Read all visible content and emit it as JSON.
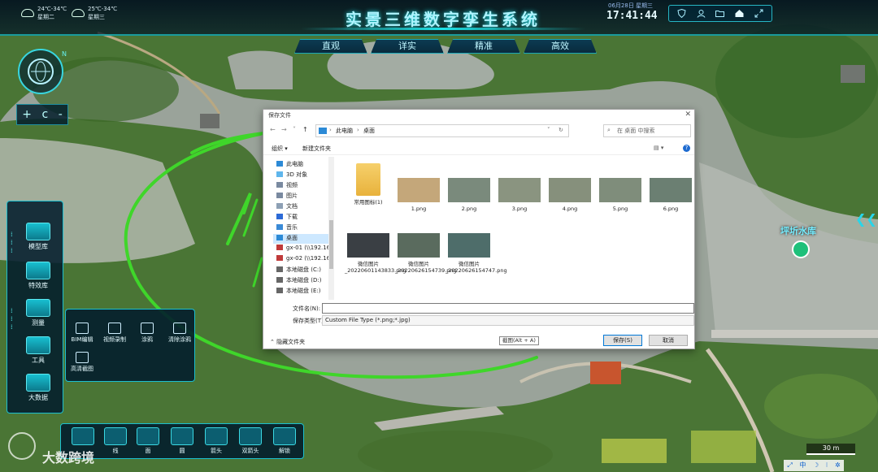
{
  "header": {
    "title": "实景三维数字孪生系统",
    "weather": [
      {
        "temp": "24℃-34℃",
        "day": "星期二"
      },
      {
        "temp": "25℃-34℃",
        "day": "星期三"
      }
    ],
    "date": "06月28日 星期三",
    "time": "17:41:44",
    "icons": [
      "shield-icon",
      "user-icon",
      "folder-icon",
      "home-icon",
      "fullscreen-icon"
    ]
  },
  "mode_tabs": [
    "直观",
    "详实",
    "精准",
    "高效"
  ],
  "compass": {
    "north": "N"
  },
  "zoom": {
    "plus": "+",
    "reset": "c",
    "minus": "-"
  },
  "sidebar": {
    "items": [
      {
        "label": "模型库",
        "icon": "cube-stack-icon"
      },
      {
        "label": "特效库",
        "icon": "effects-icon"
      },
      {
        "label": "测量",
        "icon": "ruler-icon"
      },
      {
        "label": "工具",
        "icon": "toolbox-icon"
      },
      {
        "label": "大数据",
        "icon": "big-data-icon"
      }
    ]
  },
  "tools": {
    "items": [
      {
        "label": "BIM编辑",
        "icon": "bim-edit-icon"
      },
      {
        "label": "视频录制",
        "icon": "video-record-icon"
      },
      {
        "label": "涂鸦",
        "icon": "pen-icon"
      },
      {
        "label": "清除涂鸦",
        "icon": "eraser-icon"
      },
      {
        "label": "高清截图",
        "icon": "screenshot-icon"
      }
    ]
  },
  "drawbar": {
    "items": [
      {
        "label": "",
        "icon": "point-icon"
      },
      {
        "label": "线",
        "icon": "line-icon"
      },
      {
        "label": "面",
        "icon": "polygon-icon"
      },
      {
        "label": "圆",
        "icon": "circle-icon"
      },
      {
        "label": "箭头",
        "icon": "arrow-icon"
      },
      {
        "label": "双箭头",
        "icon": "double-arrow-icon"
      },
      {
        "label": "解锁",
        "icon": "unlock-icon"
      }
    ]
  },
  "watermark": "大数跨境",
  "map": {
    "poi_label": "坪圻水库",
    "scale": "30 m",
    "tools": [
      "⤢",
      "中",
      "☽",
      "⁝",
      "✲"
    ]
  },
  "dialog": {
    "title": "保存文件",
    "close": "✕",
    "breadcrumb": [
      "此电脑",
      "桌面"
    ],
    "search_placeholder": "在 桌面 中搜索",
    "organize": "组织 ▾",
    "new_folder": "新建文件夹",
    "nav": [
      {
        "label": "此电脑",
        "icon": "pc-icon"
      },
      {
        "label": "3D 对象",
        "icon": "3d-objects-icon"
      },
      {
        "label": "视频",
        "icon": "video-folder-icon"
      },
      {
        "label": "图片",
        "icon": "pictures-folder-icon"
      },
      {
        "label": "文档",
        "icon": "documents-folder-icon"
      },
      {
        "label": "下载",
        "icon": "download-icon"
      },
      {
        "label": "音乐",
        "icon": "music-icon"
      },
      {
        "label": "桌面",
        "icon": "desktop-icon"
      },
      {
        "label": "gx-01 (\\\\192.16",
        "icon": "network-drive-icon"
      },
      {
        "label": "gx-02 (\\\\192.16",
        "icon": "network-drive-icon"
      },
      {
        "label": "本地磁盘 (C:)",
        "icon": "disk-icon"
      },
      {
        "label": "本地磁盘 (D:)",
        "icon": "disk-icon"
      },
      {
        "label": "本地磁盘 (E:)",
        "icon": "disk-icon"
      }
    ],
    "files": [
      {
        "name": "常用图标(1)",
        "kind": "folder"
      },
      {
        "name": "1.png",
        "kind": "image",
        "color": "#c4a77a"
      },
      {
        "name": "2.png",
        "kind": "image",
        "color": "#7a8a7c"
      },
      {
        "name": "3.png",
        "kind": "image",
        "color": "#8a9480"
      },
      {
        "name": "4.png",
        "kind": "image",
        "color": "#86907c"
      },
      {
        "name": "5.png",
        "kind": "image",
        "color": "#7f8d7b"
      },
      {
        "name": "6.png",
        "kind": "image",
        "color": "#6b7f72"
      },
      {
        "name": "微信图片_20220601143833.png",
        "kind": "image",
        "color": "#3a3f44"
      },
      {
        "name": "微信图片_20220626154739.png",
        "kind": "image",
        "color": "#5a6b5e"
      },
      {
        "name": "微信图片_20220626154747.png",
        "kind": "image",
        "color": "#4e6d6a"
      }
    ],
    "filename_label": "文件名(N):",
    "filename_value": "",
    "filetype_label": "保存类型(T):",
    "filetype_value": "Custom File Type (*.png;*.jpg)",
    "hide_folders": "隐藏文件夹",
    "tooltip": "截图(Alt + A)",
    "save": "保存(S)",
    "cancel": "取消"
  },
  "colors": {
    "accent": "#1ee3e8",
    "panel": "#031e2c",
    "annotation": "#3fd62a"
  }
}
